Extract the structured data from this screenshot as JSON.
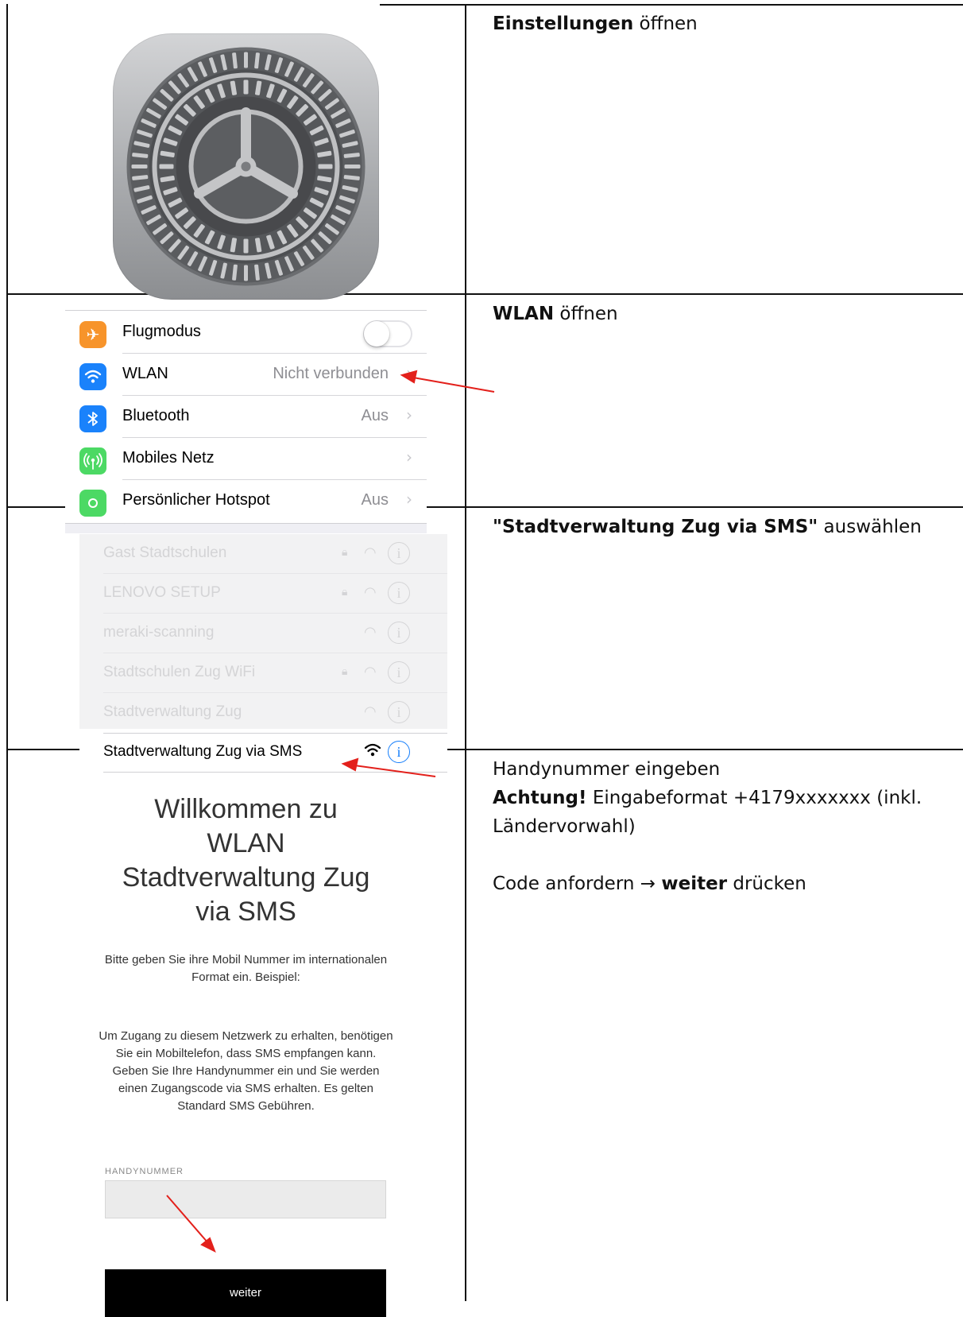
{
  "rows": [
    {
      "step": "settings",
      "bold": "Einstellungen",
      "text": " öffnen"
    },
    {
      "step": "wlan",
      "bold": "WLAN",
      "text": " öffnen",
      "settings_list": [
        {
          "label": "Flugmodus",
          "icon": "airplane-icon",
          "icon_color": "#f7942b",
          "toggle": false
        },
        {
          "label": "WLAN",
          "value": "Nicht verbunden",
          "icon": "wifi-icon",
          "icon_color": "#1a82fb"
        },
        {
          "label": "Bluetooth",
          "value": "Aus",
          "icon": "bluetooth-icon",
          "icon_color": "#1a82fb"
        },
        {
          "label": "Mobiles Netz",
          "value": "",
          "icon": "antenna-icon",
          "icon_color": "#4cd964"
        },
        {
          "label": "Persönlicher Hotspot",
          "value": "Aus",
          "icon": "hotspot-icon",
          "icon_color": "#4cd964"
        }
      ]
    },
    {
      "step": "network",
      "bold": "\"Stadtverwaltung Zug via SMS\"",
      "text": " auswählen",
      "networks": [
        {
          "name": "Gast Stadtschulen",
          "locked": true
        },
        {
          "name": "LENOVO SETUP",
          "locked": true
        },
        {
          "name": "meraki-scanning",
          "locked": false
        },
        {
          "name": "Stadtschulen Zug WiFi",
          "locked": true
        },
        {
          "name": "Stadtverwaltung Zug",
          "locked": false
        }
      ],
      "selected_network": "Stadtverwaltung Zug via SMS"
    },
    {
      "step": "portal",
      "line1": "Handynummer eingeben",
      "warn_bold": "Achtung!",
      "warn_text": " Eingabeformat +4179xxxxxxx (inkl. Ländervorwahl)",
      "line3_pre": "Code anfordern ",
      "line3_arrow": "→",
      "line3_bold": "weiter",
      "line3_post": " drücken",
      "portal": {
        "title": "Willkommen zu\nWLAN\nStadtverwaltung Zug\nvia SMS",
        "intro": "Bitte geben Sie ihre Mobil Nummer im internationalen Format ein. Beispiel:",
        "body": "Um Zugang zu diesem Netzwerk zu erhalten, benötigen Sie ein Mobiltelefon, dass SMS empfangen kann. Geben Sie Ihre Handynummer ein und Sie werden einen Zugangscode via SMS erhalten. Es gelten Standard SMS Gebühren.",
        "field_label": "HANDYNUMMER",
        "field_value": "",
        "button": "weiter"
      }
    }
  ],
  "colors": {
    "annotation_arrow": "#e3201b",
    "ios_blue": "#157efb"
  }
}
